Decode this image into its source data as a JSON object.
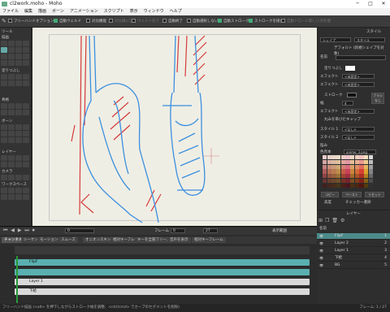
{
  "window": {
    "title": "cl2work.moho - Moho",
    "controls": [
      "─",
      "□",
      "✕"
    ]
  },
  "menu": [
    "ファイル",
    "編集",
    "描画",
    "ボーン",
    "アニメーション",
    "スクリプト",
    "表示",
    "ウィンドウ",
    "ヘルプ"
  ],
  "document_tab": "cl2work.moho",
  "options": [
    {
      "label": "フリーハンドオプション",
      "on": false,
      "dim": false
    },
    {
      "label": "自動ウェルド",
      "on": true,
      "dim": false
    },
    {
      "label": "対比機能",
      "on": false,
      "dim": false
    },
    {
      "label": "対比線に沿",
      "on": false,
      "dim": true
    },
    {
      "label": "ウェルド先で",
      "on": false,
      "dim": true
    },
    {
      "label": "自動終了",
      "on": false,
      "dim": false
    },
    {
      "label": "自動選択しない",
      "on": false,
      "dim": false
    },
    {
      "label": "自動ストローク",
      "on": true,
      "dim": false
    },
    {
      "label": "ストロークを接合",
      "on": true,
      "dim": false
    },
    {
      "label": "自動ドローに新しい点を使",
      "on": false,
      "dim": true
    }
  ],
  "tools": {
    "header": "ツール",
    "sections": [
      "描画",
      "塗りつぶし",
      "骨格",
      "ボーン",
      "レイヤー",
      "カメラ",
      "ワークスペース"
    ]
  },
  "style": {
    "header": "スタイル",
    "style_select": "シェイプ",
    "style_select2": "スタイル",
    "defaults": "デフォルト (新規シェイプを対象)",
    "name_label": "名前",
    "fill_label": "塗りつぶし",
    "effect1_label": "エフェクト",
    "effect1_value": "<未設定>",
    "effect2_label": "エフェクト",
    "effect2_value": "<未設定>",
    "stroke_label": "ストローク",
    "width_label": "幅",
    "width_value": "4",
    "brush_button": "ブラシなし",
    "effect3_label": "エフェクト",
    "effect3_value": "<未設定>",
    "cap_label": "丸みを帯びたキャップ",
    "style1_label": "スタイル 1",
    "style1_value": "<なし>",
    "style2_label": "スタイル 2",
    "style2_value": "<なし>",
    "shade_label": "陰み",
    "swatch_label": "色見本",
    "swatch_value": "anime_3.png",
    "copy_button": "コピー",
    "paste_button": "ペースト",
    "reset_button": "リセット",
    "advanced_label": "高度",
    "checker_label": "チェッカー選択"
  },
  "layers": {
    "header": "レイヤー",
    "name_label": "名前",
    "items": [
      {
        "name": "FlipF",
        "num": "1",
        "selected": true
      },
      {
        "name": "Layer 2",
        "num": "2",
        "selected": false
      },
      {
        "name": "Layer 1",
        "num": "3",
        "selected": false
      },
      {
        "name": "下絵",
        "num": "4",
        "selected": false
      },
      {
        "name": "BG",
        "num": "5",
        "selected": false
      }
    ]
  },
  "timeline": {
    "frame_value": "0",
    "frame_label": "フレーム",
    "frame_of": "0",
    "end_value": "27",
    "display_range": "表示範囲",
    "tabs": [
      "チャンネル",
      "シーケンサ",
      "モーショングラフ",
      "スムーズ",
      "オニオンスキン",
      "相対キーフレーム",
      "キーを全部フリーズ",
      "音声を表示",
      "相対キーフレーム"
    ],
    "tracks": [
      {
        "name": "FlipF",
        "color": "#5ab0b0"
      },
      {
        "name": "",
        "color": "#5ab0b0"
      },
      {
        "name": "Layer 1",
        "color": "#d9d9d9"
      },
      {
        "name": "下絵",
        "color": "#d9d9d9"
      }
    ]
  },
  "status": {
    "text": "フリーハンド描画 (<alt> を押下しながらストローク幅を調整、<ctrl/cmd> でカーブのセグメントを削除)",
    "frame": "フレーム: 1 / 27"
  },
  "colors": {
    "accent": "#5ab0b0",
    "canvas": "#efeee4",
    "blue_stroke": "#3b8fe0",
    "red_stroke": "#d43a3a"
  }
}
